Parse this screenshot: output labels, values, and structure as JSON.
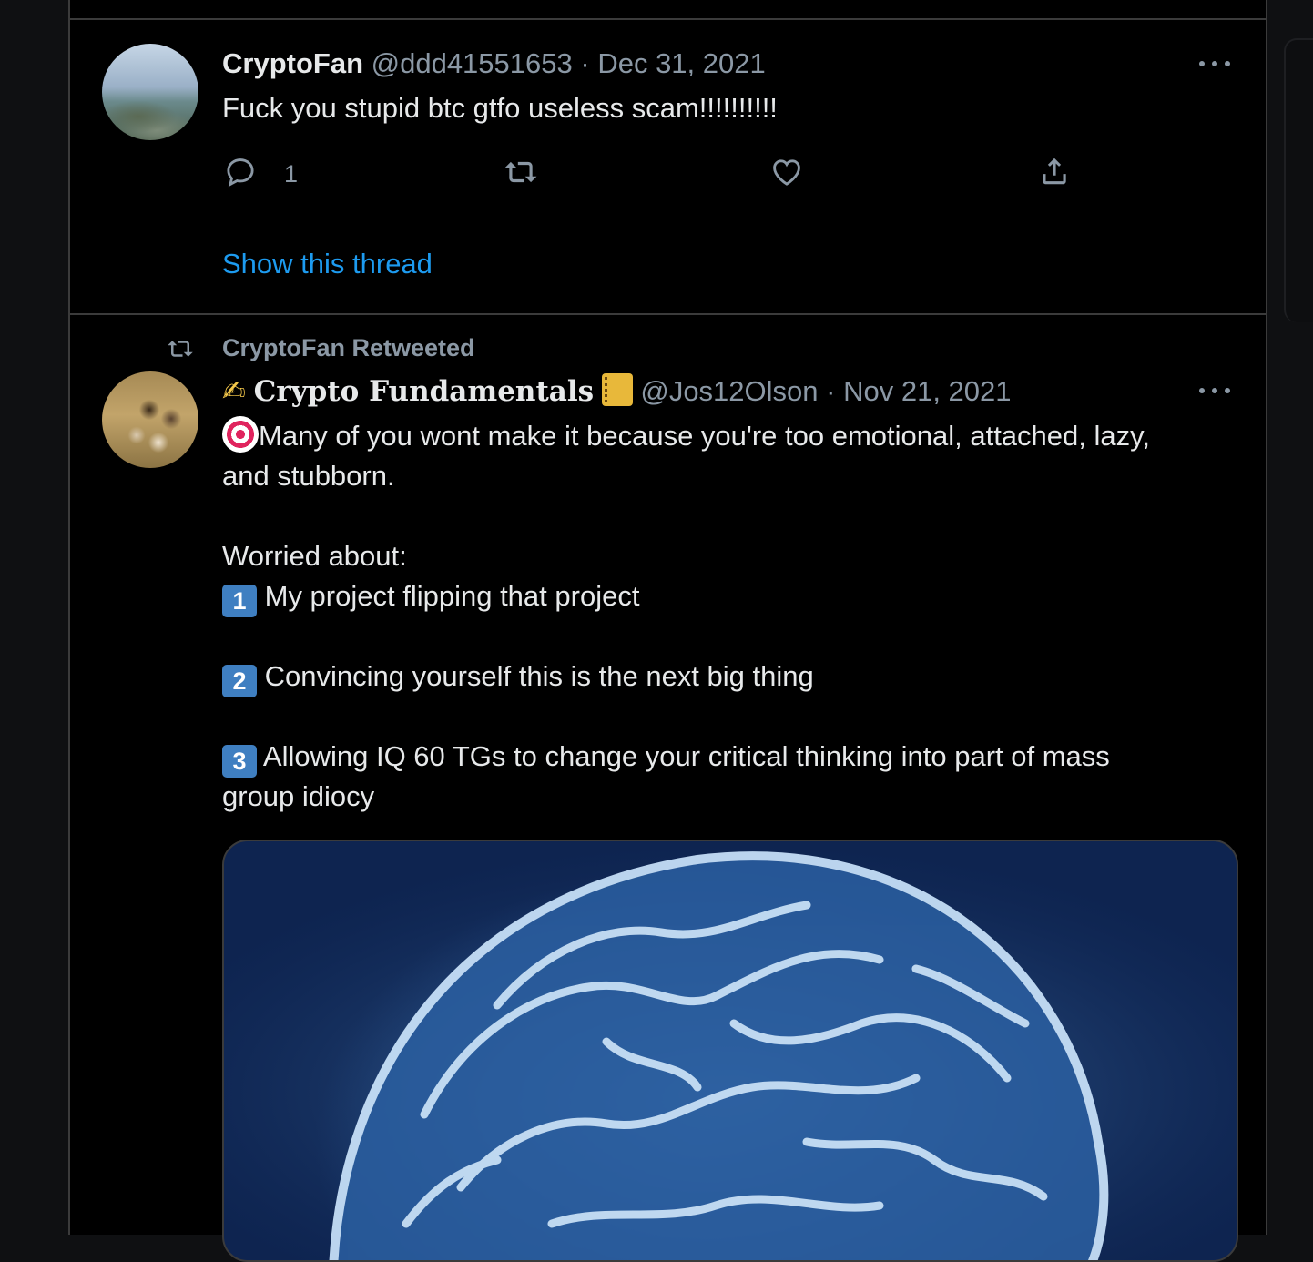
{
  "tweet1": {
    "display_name": "CryptoFan",
    "handle": "@ddd41551653",
    "separator": "·",
    "date": "Dec 31, 2021",
    "text": "Fuck you stupid btc gtfo useless scam!!!!!!!!!!",
    "reply_count": "1",
    "show_thread": "Show this thread"
  },
  "tweet2": {
    "retweeted_by": "CryptoFan Retweeted",
    "emoji_prefix": "✍",
    "display_name": "Crypto Fundamentals",
    "emoji_suffix": "📒",
    "handle": "@Jos12Olson",
    "separator": "·",
    "date": "Nov 21, 2021",
    "line1_emoji": "🎯",
    "line1": "Many of you wont make it because you're too emotional, attached, lazy,",
    "line2": "and stubborn.",
    "worried": "Worried about:",
    "items": [
      {
        "num": "1",
        "text": "My project flipping that project"
      },
      {
        "num": "2",
        "text": "Convincing yourself this is the next big thing"
      },
      {
        "num": "3",
        "text": "Allowing IQ 60 TGs to change your critical thinking into part of mass"
      }
    ],
    "item3_cont": "group idiocy"
  },
  "icons": {
    "reply": "reply-icon",
    "retweet": "retweet-icon",
    "like": "heart-icon",
    "share": "share-icon",
    "more": "more-icon"
  },
  "colors": {
    "background": "#000000",
    "text": "#e7e9ea",
    "muted": "#8b98a5",
    "link": "#1d9bf0",
    "keycap": "#3f7fc1"
  }
}
